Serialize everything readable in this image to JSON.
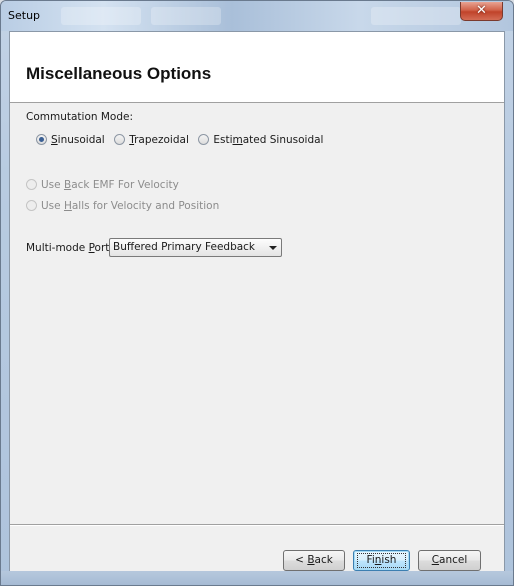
{
  "window": {
    "title": "Setup",
    "close_label": "✕"
  },
  "page": {
    "heading": "Miscellaneous Options"
  },
  "commutation": {
    "label": "Commutation Mode:",
    "options": [
      {
        "pre": "",
        "mn": "S",
        "post": "inusoidal",
        "checked": true
      },
      {
        "pre": "",
        "mn": "T",
        "post": "rapezoidal",
        "checked": false
      },
      {
        "pre": "Esti",
        "mn": "m",
        "post": "ated Sinusoidal",
        "checked": false
      }
    ]
  },
  "velocity": {
    "back_emf": {
      "pre": "Use ",
      "mn": "B",
      "post": "ack EMF For Velocity"
    },
    "halls": {
      "pre": "Use ",
      "mn": "H",
      "post": "alls for Velocity and Position"
    }
  },
  "multimode": {
    "label_pre": "Multi-mode ",
    "label_mn": "P",
    "label_post": "ort:",
    "selected": "Buffered Primary Feedback"
  },
  "buttons": {
    "back": {
      "pre": "< ",
      "mn": "B",
      "post": "ack"
    },
    "finish": {
      "pre": "Fi",
      "mn": "n",
      "post": "ish"
    },
    "cancel": {
      "pre": "",
      "mn": "C",
      "post": "ancel"
    }
  },
  "colors": {
    "accent_radio": "#3a5f94",
    "default_button_border": "#3c7fb1",
    "close_button": "#c0432a"
  }
}
